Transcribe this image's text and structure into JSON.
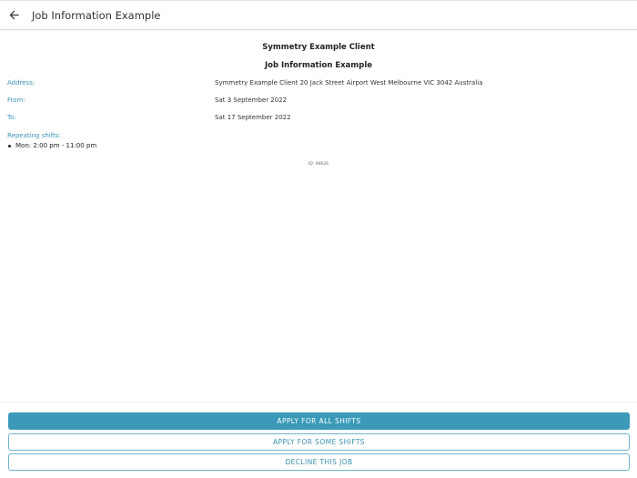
{
  "header": {
    "title": "Job Information Example",
    "back_icon": "arrow-left-icon"
  },
  "job": {
    "client_name": "Symmetry Example Client",
    "title": "Job Information Example",
    "address_label": "Address:",
    "address_value": "Symmetry Example Client 20 Jack Street Airport West Melbourne VIC 3042 Australia",
    "from_label": "From:",
    "from_value": "Sat 3 September 2022",
    "to_label": "To:",
    "to_value": "Sat 17 September 2022",
    "repeating_label": "Repeating shifts:",
    "shifts": [
      "Mon: 2:00 pm - 11:00 pm"
    ],
    "id_text": "ID: 94626"
  },
  "actions": {
    "apply_all": "APPLY FOR ALL SHIFTS",
    "apply_some": "APPLY FOR SOME SHIFTS",
    "decline": "DECLINE THIS JOB"
  },
  "colors": {
    "accent": "#3a9ab8",
    "label": "#3a93b5"
  }
}
